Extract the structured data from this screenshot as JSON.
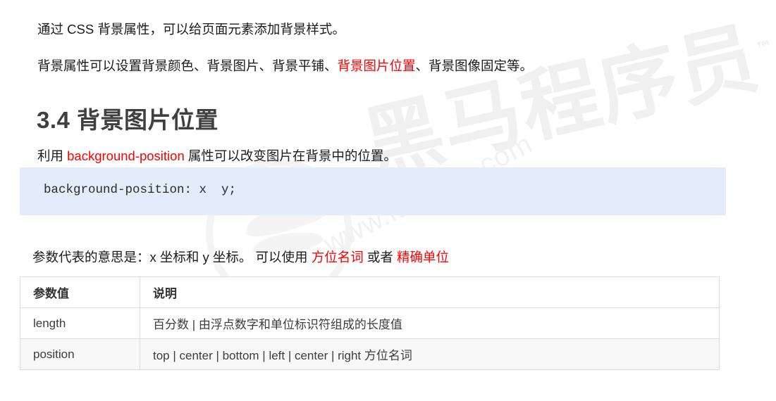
{
  "document": {
    "intro_paragraph": {
      "text": "通过 CSS 背景属性，可以给页面元素添加背景样式。"
    },
    "properties_paragraph": {
      "prefix": "背景属性可以设置背景颜色、背景图片、背景平铺、",
      "highlight": "背景图片位置",
      "suffix": "、背景图像固定等。"
    },
    "heading": {
      "number": "3.4",
      "title": "背景图片位置",
      "full": "3.4 背景图片位置"
    },
    "usage_paragraph": {
      "prefix": "利用 ",
      "highlight": "background-position",
      "suffix": " 属性可以改变图片在背景中的位置。"
    },
    "code_block": {
      "code": "background-position: x  y;"
    },
    "params_paragraph": {
      "prefix": "参数代表的意思是：x 坐标和 y 坐标。 可以使用 ",
      "highlight_one": "方位名词",
      "middle": " 或者 ",
      "highlight_two": "精确单位"
    },
    "table": {
      "headers": [
        "参数值",
        "说明"
      ],
      "rows": [
        {
          "key": "length",
          "description": "百分数 | 由浮点数字和单位标识符组成的长度值"
        },
        {
          "key": "position",
          "description": "top | center | bottom | left | center | right  方位名词"
        }
      ]
    }
  },
  "watermark": {
    "brand": "黑马程序员",
    "trademark": "™",
    "url": "www.itheima.com"
  },
  "colors": {
    "highlight_red": "#ff0000",
    "code_background": "#e3ecfb",
    "heading": "#3f3f3f",
    "table_border": "#dcdcdc",
    "watermark": "#f1f1f1"
  }
}
